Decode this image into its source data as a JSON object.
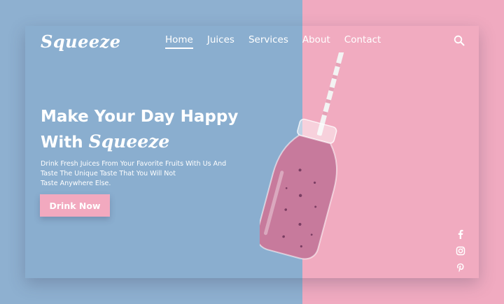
{
  "brand": {
    "logo": "Squeeze"
  },
  "nav": {
    "items": [
      "Home",
      "Juices",
      "Services",
      "About",
      "Contact"
    ],
    "active": "Home"
  },
  "hero": {
    "headline_line1": "Make Your Day Happy",
    "headline_with": "With",
    "headline_brand": "Squeeze",
    "description_line1": "Drink Fresh Juices From Your Favorite Fruits With Us And",
    "description_line2": "Taste The Unique Taste That You Will Not",
    "description_line3": "Taste Anywhere Else.",
    "cta_label": "Drink Now"
  },
  "icons": {
    "search": "search-icon",
    "social": [
      "facebook-icon",
      "instagram-icon",
      "pinterest-icon"
    ]
  },
  "colors": {
    "blue_panel": "#8aaecf",
    "pink_panel": "#f1abc0",
    "button": "#f2a9bf",
    "smoothie": "#c77a9c",
    "text": "#ffffff"
  }
}
